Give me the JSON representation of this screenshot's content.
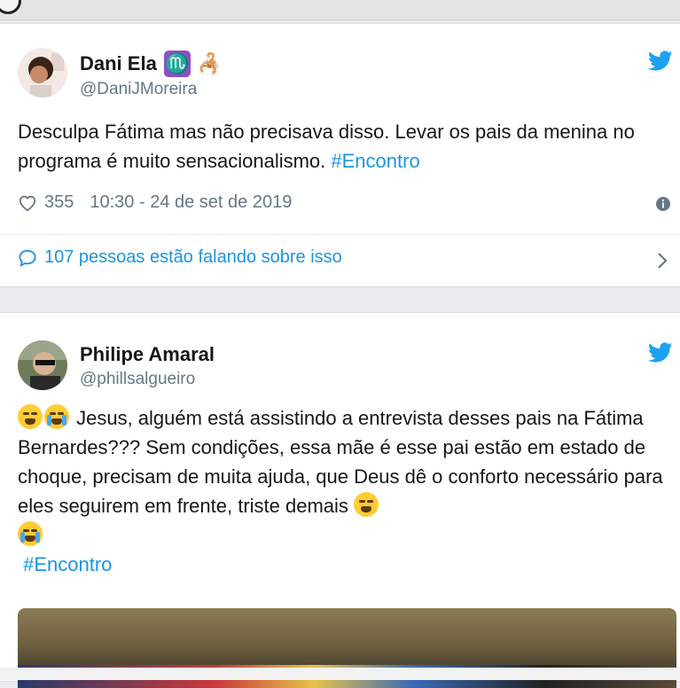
{
  "tweets": [
    {
      "name": "Dani Ela",
      "name_badge_glyph": "♏",
      "name_extra_glyph": "🦂",
      "handle": "@DaniJMoreira",
      "text_plain": "Desculpa Fátima mas não precisava disso. Levar os pais da menina no programa é muito sensacionalismo. ",
      "hashtag": "#Encontro",
      "likes": "355",
      "timestamp": "10:30 - 24 de set de 2019",
      "conversation_label": "107 pessoas estão falando sobre isso"
    },
    {
      "name": "Philipe Amaral",
      "handle": "@phillsalgueiro",
      "text_plain": " Jesus, alguém está assistindo a entrevista desses pais na Fátima Bernardes??? Sem condições, essa mãe é esse pai estão em estado de choque, precisam de muita ajuda, que Deus dê o conforto necessário para eles seguirem em frente, triste demais ",
      "hashtag": "#Encontro"
    }
  ],
  "icons": {
    "bird": "twitter-bird-icon",
    "heart": "heart-icon",
    "info": "info-icon",
    "comment": "comment-bubble-icon",
    "chevron": "chevron-right-icon",
    "emoji_weary": "weary-face-emoji",
    "emoji_crying": "loudly-crying-face-emoji"
  },
  "colors": {
    "link": "#1b95e0",
    "secondary_text": "#657786",
    "twitter_blue": "#1da1f2",
    "zodiac_badge": "#8e4fc3"
  }
}
